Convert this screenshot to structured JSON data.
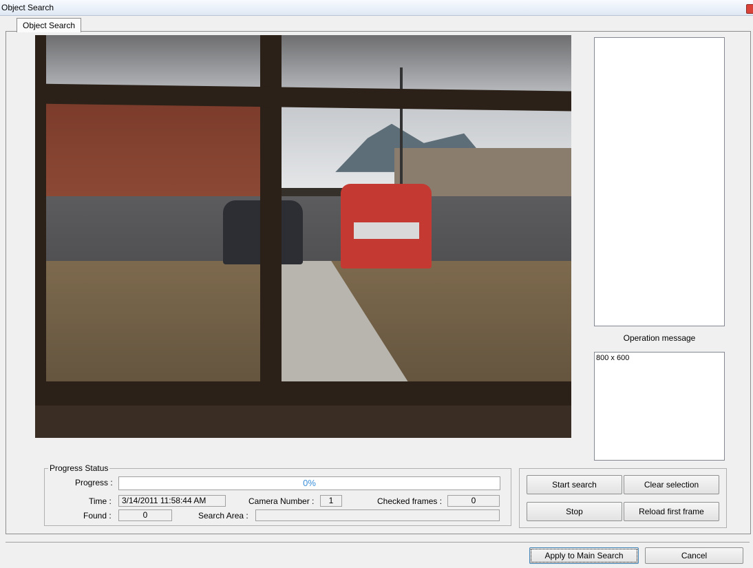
{
  "window": {
    "title": "Object Search"
  },
  "tabs": [
    {
      "label": "Object Search"
    }
  ],
  "operation": {
    "label": "Operation message",
    "message": "800 x 600"
  },
  "progress_status": {
    "group_label": "Progress Status",
    "progress_label": "Progress :",
    "progress_value": 0,
    "progress_text": "0%",
    "time_label": "Time :",
    "time_value": "3/14/2011 11:58:44 AM",
    "camera_label": "Camera Number :",
    "camera_value": "1",
    "checked_label": "Checked frames :",
    "checked_value": "0",
    "found_label": "Found :",
    "found_value": "0",
    "search_area_label": "Search Area :",
    "search_area_value": ""
  },
  "actions": {
    "start_search": "Start search",
    "clear_selection": "Clear selection",
    "stop": "Stop",
    "reload_first_frame": "Reload first frame"
  },
  "footer": {
    "apply": "Apply to Main Search",
    "cancel": "Cancel"
  },
  "colors": {
    "progress_text": "#3b8fd8",
    "close_button": "#d9433a"
  }
}
